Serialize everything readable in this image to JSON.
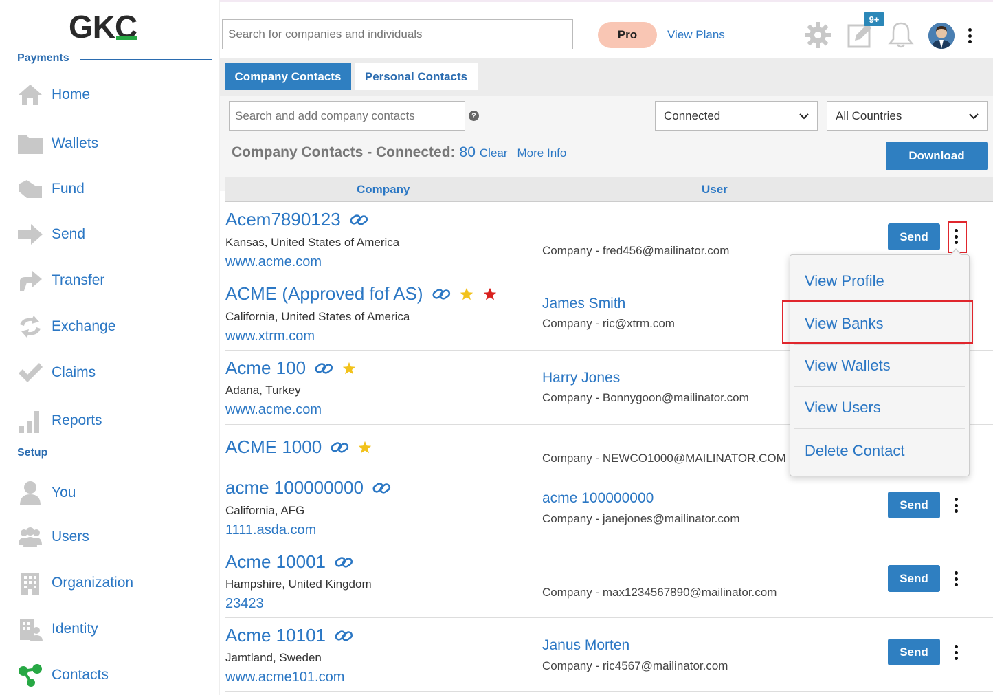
{
  "brand": {
    "logo_text": "GKC",
    "accent": "#27a844",
    "primary": "#2f7fc1",
    "link": "#2b77c4"
  },
  "sidebar": {
    "payments_label": "Payments",
    "setup_label": "Setup",
    "payments_items": [
      {
        "label": "Home",
        "icon": "home-icon"
      },
      {
        "label": "Wallets",
        "icon": "folder-icon"
      },
      {
        "label": "Fund",
        "icon": "fund-icon"
      },
      {
        "label": "Send",
        "icon": "arrow-right-icon"
      },
      {
        "label": "Transfer",
        "icon": "transfer-icon"
      },
      {
        "label": "Exchange",
        "icon": "exchange-icon"
      },
      {
        "label": "Claims",
        "icon": "check-icon"
      },
      {
        "label": "Reports",
        "icon": "bar-chart-icon"
      }
    ],
    "setup_items": [
      {
        "label": "You",
        "icon": "user-icon"
      },
      {
        "label": "Users",
        "icon": "users-icon"
      },
      {
        "label": "Organization",
        "icon": "building-icon"
      },
      {
        "label": "Identity",
        "icon": "identity-icon"
      },
      {
        "label": "Contacts",
        "icon": "contacts-icon"
      }
    ]
  },
  "topbar": {
    "search_placeholder": "Search for companies and individuals",
    "pro_label": "Pro",
    "view_plans_label": "View Plans",
    "notification_badge": "9+"
  },
  "tabs": {
    "company": "Company Contacts",
    "personal": "Personal Contacts"
  },
  "filters": {
    "search_placeholder": "Search and add company contacts",
    "help": "?",
    "status_value": "Connected",
    "country_value": "All Countries"
  },
  "summary": {
    "title": "Company Contacts - Connected:",
    "count": "80",
    "clear_label": "Clear",
    "more_info_label": "More Info",
    "download_label": "Download"
  },
  "table": {
    "col_company": "Company",
    "col_user": "User",
    "send_label": "Send",
    "rows": [
      {
        "name": "Acem7890123",
        "location": "Kansas, United States of America",
        "website": "www.acme.com",
        "user": "",
        "email": "Company - fred456@mailinator.com",
        "stars": []
      },
      {
        "name": "ACME (Approved fof AS)",
        "location": "California, United States of America",
        "website": "www.xtrm.com",
        "user": "James Smith",
        "email": "Company - ric@xtrm.com",
        "stars": [
          "gold",
          "red"
        ]
      },
      {
        "name": "Acme 100",
        "location": "Adana, Turkey",
        "website": "www.acme.com",
        "user": "Harry Jones",
        "email": "Company - Bonnygoon@mailinator.com",
        "stars": [
          "gold"
        ]
      },
      {
        "name": "ACME 1000",
        "location": "",
        "website": "",
        "user": "",
        "email": "Company - NEWCO1000@MAILINATOR.COM",
        "stars": [
          "gold"
        ]
      },
      {
        "name": "acme 100000000",
        "location": "California, AFG",
        "website": "1111.asda.com",
        "user": "acme 100000000",
        "email": "Company - janejones@mailinator.com",
        "stars": []
      },
      {
        "name": "Acme 10001",
        "location": "Hampshire, United Kingdom",
        "website": "23423",
        "user": "",
        "email": "Company - max1234567890@mailinator.com",
        "stars": []
      },
      {
        "name": "Acme 10101",
        "location": "Jamtland, Sweden",
        "website": "www.acme101.com",
        "user": "Janus Morten",
        "email": "Company - ric4567@mailinator.com",
        "stars": []
      }
    ]
  },
  "dropdown": {
    "items": [
      "View Profile",
      "View Banks",
      "View Wallets",
      "View Users",
      "Delete Contact"
    ]
  }
}
